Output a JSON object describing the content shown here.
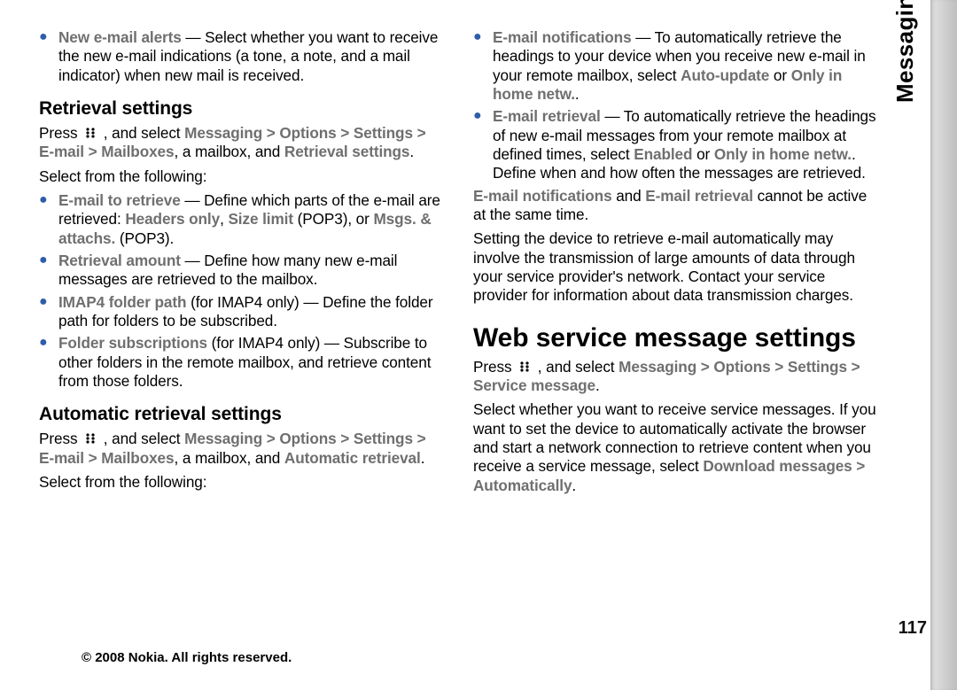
{
  "section_tab": "Messaging",
  "page_number": "117",
  "footer": "© 2008 Nokia. All rights reserved.",
  "newmail": {
    "t": "New e-mail alerts",
    "d": " — Select whether you want to receive the new e-mail indications (a tone, a note, and a mail indicator) when new mail is received."
  },
  "retr_h": "Retrieval settings",
  "retr_lead_a": "Press ",
  "retr_lead_b": " , and select ",
  "retr_path": "Messaging  >  Options  >  Settings  >  E-mail  >  Mailboxes",
  "retr_lead_c": ", a mailbox, and ",
  "retr_path2": "Retrieval settings",
  "retr_lead_d": ".",
  "retr_select": "Select from the following:",
  "r1": {
    "t": "E-mail to retrieve",
    "d1": " — Define which parts of the e-mail are retrieved: ",
    "g1": "Headers only",
    "d2": ", ",
    "g2": "Size limit",
    "d3": " (POP3), or ",
    "g3": "Msgs. & attachs.",
    "d4": " (POP3)."
  },
  "r2": {
    "t": "Retrieval amount",
    "d": " — Define how many new e-mail messages are retrieved to the mailbox."
  },
  "r3": {
    "t": "IMAP4 folder path",
    "d": " (for IMAP4 only)  — Define the folder path for folders to be subscribed."
  },
  "r4": {
    "t": "Folder subscriptions",
    "d": " (for IMAP4 only)  — Subscribe to other folders in the remote mailbox, and retrieve content from those folders."
  },
  "auto_h": "Automatic retrieval settings",
  "auto_lead_a": "Press ",
  "auto_lead_b": " , and select ",
  "auto_path": "Messaging  >  Options  >  Settings  >  E-mail  >  Mailboxes",
  "auto_lead_c": ", a mailbox, and ",
  "auto_path2": "Automatic retrieval",
  "auto_lead_d": ".",
  "auto_select": "Select from the following:",
  "a1": {
    "t": "E-mail notifications",
    "d1": " — To automatically retrieve the headings to your device when you receive new e-mail in your remote mailbox, select ",
    "g1": "Auto-update",
    "d2": " or ",
    "g2": "Only in home netw.",
    "d3": "."
  },
  "a2": {
    "t": "E-mail retrieval",
    "d1": " — To automatically retrieve the headings of new e-mail messages from your remote mailbox at defined times, select ",
    "g1": "Enabled",
    "d2": " or ",
    "g2": "Only in home netw.",
    "d3": ". Define when and how often the messages are retrieved."
  },
  "note1_a": "E-mail notifications",
  "note1_b": " and ",
  "note1_c": "E-mail retrieval",
  "note1_d": " cannot be active at the same time.",
  "note2": "Setting the device to retrieve e-mail automatically may involve the transmission of large amounts of data through your service provider's network. Contact your service provider for information about data transmission charges.",
  "web_h": "Web service message settings",
  "web_lead_a": "Press ",
  "web_lead_b": " , and select ",
  "web_path": "Messaging  >  Options  >  Settings  >  Service message",
  "web_lead_d": ".",
  "web_body_a": "Select whether you want to receive service messages. If you want to set the device to automatically activate the browser and start a network connection to retrieve content when you receive a service message, select ",
  "web_body_g": "Download messages  >  Automatically",
  "web_body_b": "."
}
